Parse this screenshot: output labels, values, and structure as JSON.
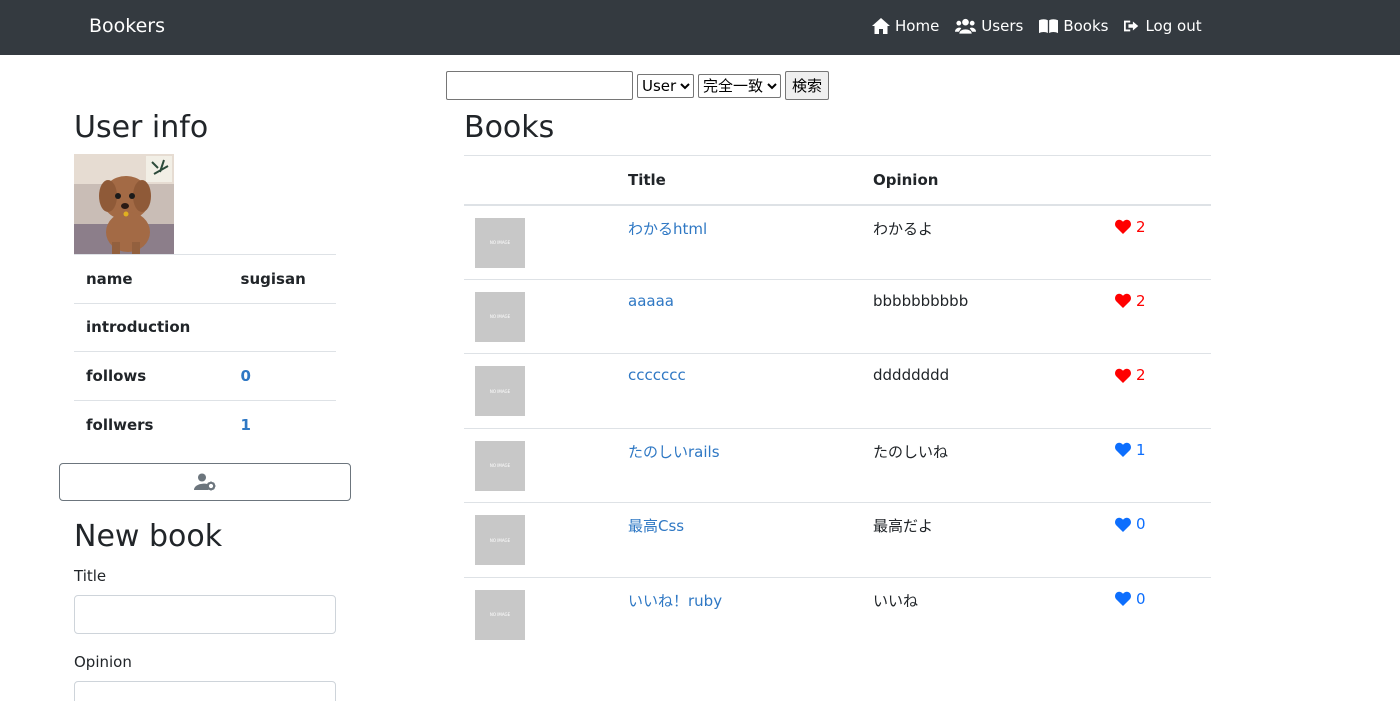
{
  "nav": {
    "brand": "Bookers",
    "links": [
      {
        "label": "Home",
        "icon": "home-icon"
      },
      {
        "label": "Users",
        "icon": "users-icon"
      },
      {
        "label": "Books",
        "icon": "book-icon"
      },
      {
        "label": "Log out",
        "icon": "logout-icon"
      }
    ]
  },
  "search": {
    "input_value": "",
    "model_selected": "User",
    "method_selected": "完全一致",
    "button_label": "検索"
  },
  "user_info": {
    "heading": "User info",
    "rows": [
      {
        "label": "name",
        "value": "sugisan"
      },
      {
        "label": "introduction",
        "value": ""
      },
      {
        "label": "follows",
        "value": "0"
      },
      {
        "label": "follwers",
        "value": "1"
      }
    ],
    "edit_icon": "user-cog-icon"
  },
  "new_book": {
    "heading": "New book",
    "title_label": "Title",
    "opinion_label": "Opinion"
  },
  "books": {
    "heading": "Books",
    "columns": [
      "",
      "Title",
      "Opinion",
      ""
    ],
    "no_image_text": "NO IMAGE",
    "rows": [
      {
        "title": "わかるhtml",
        "opinion": "わかるよ",
        "likes": "2",
        "liked": true
      },
      {
        "title": "aaaaa",
        "opinion": "bbbbbbbbbb",
        "likes": "2",
        "liked": true
      },
      {
        "title": "ccccccc",
        "opinion": "dddddddd",
        "likes": "2",
        "liked": true
      },
      {
        "title": "たのしいrails",
        "opinion": "たのしいね",
        "likes": "1",
        "liked": false
      },
      {
        "title": "最高Css",
        "opinion": "最高だよ",
        "likes": "0",
        "liked": false
      },
      {
        "title": "いいね！ruby",
        "opinion": "いいね",
        "likes": "0",
        "liked": false
      }
    ]
  },
  "colors": {
    "navbar": "#343a40",
    "link": "#2f78c4",
    "liked": "#ff0000",
    "unliked": "#0d6efd"
  }
}
